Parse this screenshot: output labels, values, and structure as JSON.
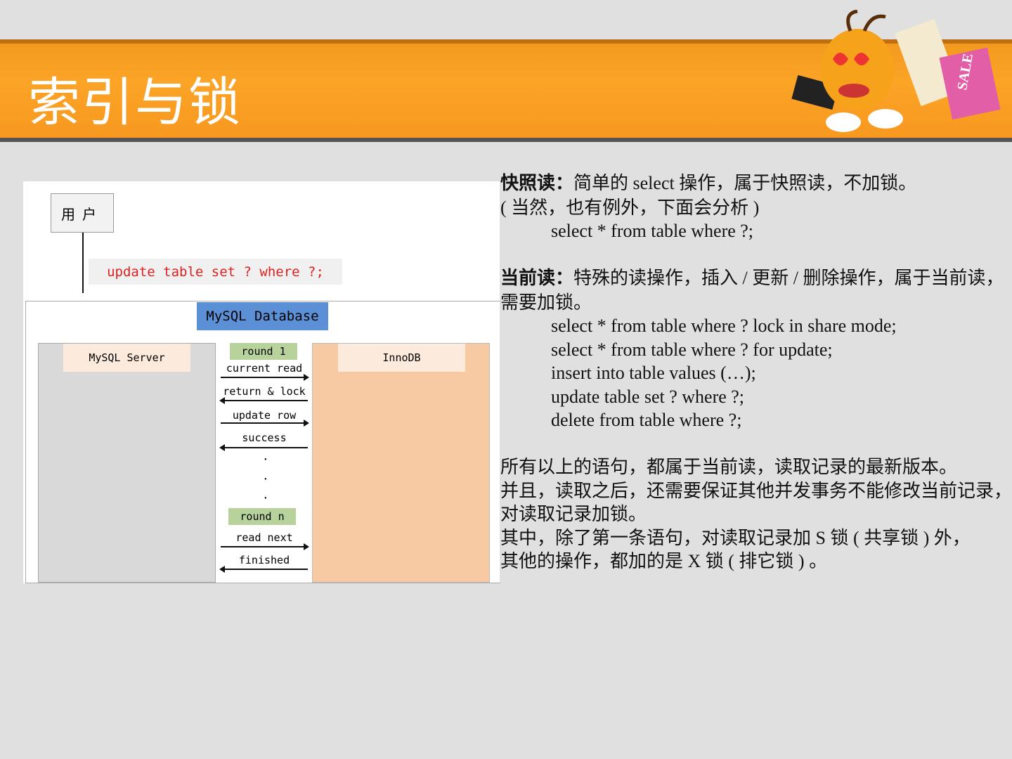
{
  "title": "索引与锁",
  "diagram": {
    "user": "用户",
    "sql": "update table set ? where ?;",
    "database": "MySQL Database",
    "server": "MySQL Server",
    "engine": "InnoDB",
    "round1": "round 1",
    "roundn": "round n",
    "dots": "·",
    "steps": [
      "current read",
      "return & lock",
      "update row",
      "success",
      "read next",
      "finished"
    ]
  },
  "content": {
    "snapshot_label": "快照读：",
    "snapshot_text": "简单的 select 操作，属于快照读，不加锁。",
    "snapshot_note": "( 当然，也有例外，下面会分析 )",
    "snapshot_sql": "select * from table where ?;",
    "current_label": "当前读：",
    "current_text": "特殊的读操作，插入 / 更新 / 删除操作，属于当前读，",
    "current_text2": "需要加锁。",
    "current_sql": [
      "select * from table where ? lock in share mode;",
      "select * from table where ? for update;",
      "insert into table values (…);",
      "update table set ? where ?;",
      "delete from table where ?;"
    ],
    "summary": [
      "所有以上的语句，都属于当前读，读取记录的最新版本。",
      "并且，读取之后，还需要保证其他并发事务不能修改当前记录，",
      "对读取记录加锁。",
      "其中，除了第一条语句，对读取记录加 S 锁 ( 共享锁 ) 外，",
      "其他的操作，都加的是 X 锁 ( 排它锁 ) 。"
    ]
  }
}
